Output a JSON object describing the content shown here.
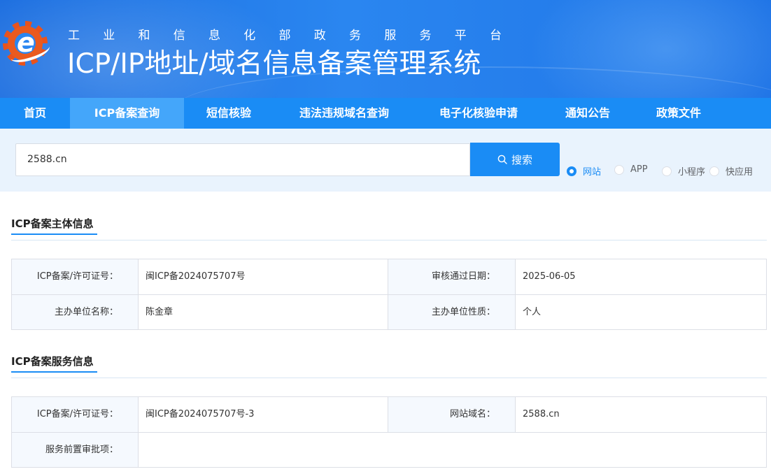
{
  "header": {
    "subtitle_chars": [
      "工",
      "业",
      "和",
      "信",
      "息",
      "化",
      "部",
      "政",
      "务",
      "服",
      "务",
      "平",
      "台"
    ],
    "title": "ICP/IP地址/域名信息备案管理系统"
  },
  "nav": {
    "items": [
      {
        "label": "首页",
        "active": false
      },
      {
        "label": "ICP备案查询",
        "active": true
      },
      {
        "label": "短信核验",
        "active": false
      },
      {
        "label": "违法违规域名查询",
        "active": false
      },
      {
        "label": "电子化核验申请",
        "active": false
      },
      {
        "label": "通知公告",
        "active": false
      },
      {
        "label": "政策文件",
        "active": false
      }
    ]
  },
  "search": {
    "value": "2588.cn",
    "button_label": "搜索",
    "button_icon": "search-icon",
    "types": [
      {
        "label": "网站",
        "checked": true
      },
      {
        "label": "APP",
        "checked": false
      },
      {
        "label": "小程序",
        "checked": false
      },
      {
        "label": "快应用",
        "checked": false
      }
    ]
  },
  "subject_section": {
    "title": "ICP备案主体信息",
    "rows": [
      {
        "label1": "ICP备案/许可证号：",
        "value1": "闽ICP备2024075707号",
        "label2": "审核通过日期：",
        "value2": "2025-06-05"
      },
      {
        "label1": "主办单位名称：",
        "value1": "陈金章",
        "label2": "主办单位性质：",
        "value2": "个人"
      }
    ]
  },
  "service_section": {
    "title": "ICP备案服务信息",
    "rows": [
      {
        "label1": "ICP备案/许可证号：",
        "value1": "闽ICP备2024075707号-3",
        "label2": "网站域名：",
        "value2": "2588.cn"
      },
      {
        "label1": "服务前置审批项：",
        "value1": ""
      }
    ]
  },
  "colors": {
    "primary": "#1a8cf5",
    "nav_active": "#44a6fa",
    "logo_orange": "#e8531d"
  }
}
